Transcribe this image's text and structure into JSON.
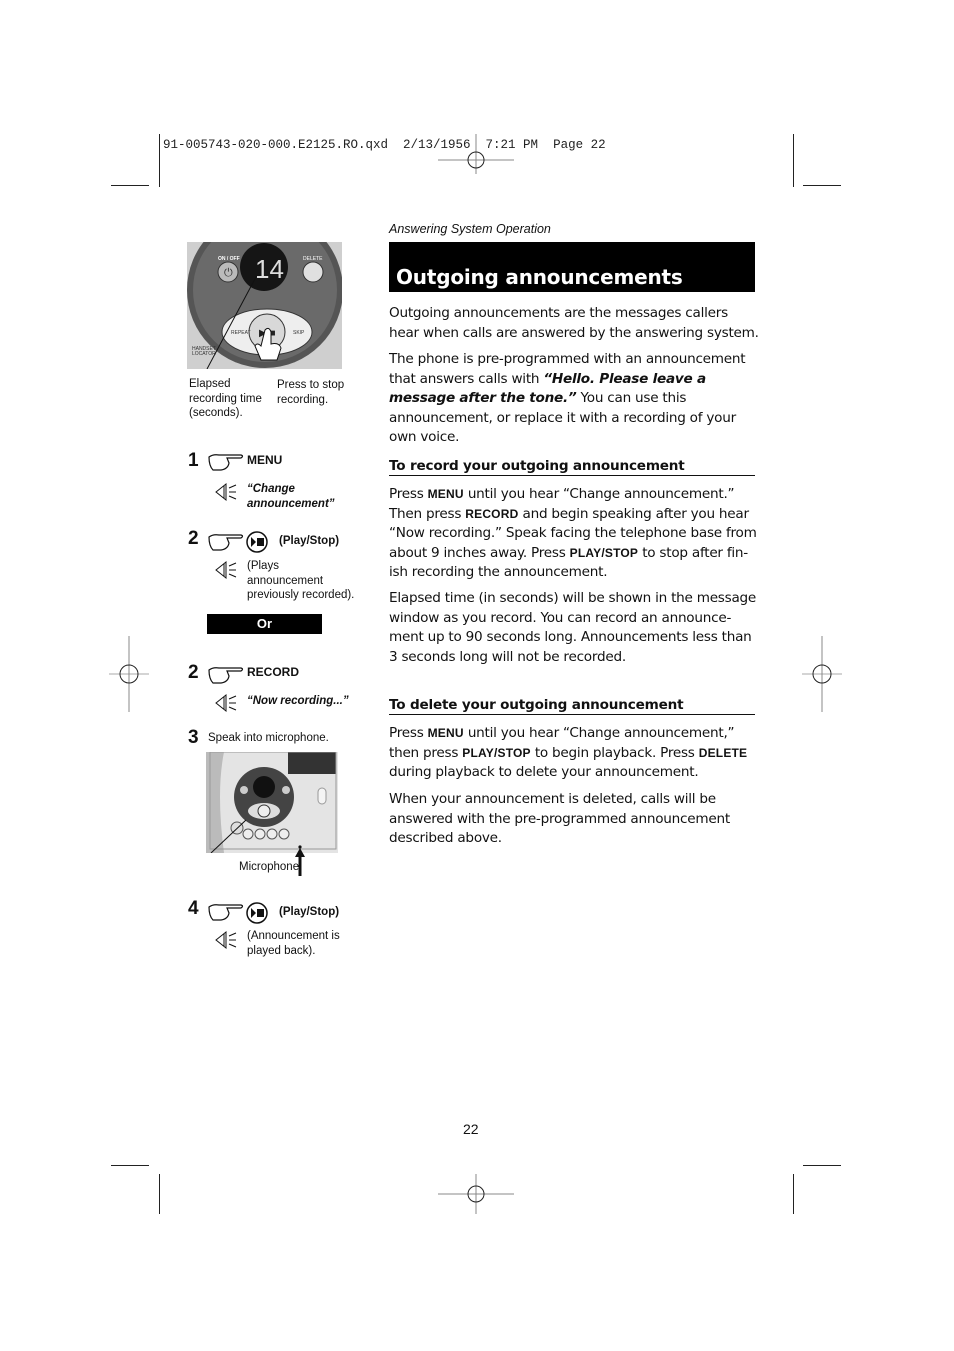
{
  "slug_line": "91-005743-020-000.E2125.RO.qxd  2/13/1956  7:21 PM  Page 22",
  "section_label": "Answering System Operation",
  "title": "Outgoing announcements",
  "intro": {
    "p1": "Outgoing announcements are the messages callers hear when calls are answered by the answering system.",
    "p2_a": "The phone is pre-programmed with an announcement that answers calls with ",
    "p2_quote": "“Hello. Please leave a message after the tone.”",
    "p2_b": " You can use this announcement, or replace it with a recording of your own voice."
  },
  "record_section": {
    "heading": "To record your outgoing announcement",
    "p1_a": "Press ",
    "kw_menu": "MENU",
    "p1_b": " until you hear “Change announcement.” Then press ",
    "kw_record": "RECORD",
    "p1_c": " and begin speaking after you hear “Now recording.” Speak facing the telephone base from about 9 inches away. Press ",
    "kw_playstop": "PLAY/STOP",
    "p1_d": " to stop after fin-ish recording the announcement.",
    "p2": "Elapsed time (in seconds) will be shown in the message window as you record. You can record an announce-ment up to 90 seconds long. Announcements less than 3 seconds long will not be recorded."
  },
  "delete_section": {
    "heading": "To delete your outgoing announcement",
    "p1_a": "Press ",
    "kw_menu": "MENU",
    "p1_b": " until you hear “Change announcement,” then press ",
    "kw_playstop": "PLAY/STOP",
    "p1_c": " to begin playback. Press ",
    "kw_delete": "DELETE",
    "p1_d": " during playback to delete your announcement.",
    "p2": "When your announcement is deleted, calls will be answered with the pre-programmed announcement described above."
  },
  "device_panel": {
    "display": "14",
    "on_off_label": "ON / OFF",
    "delete_label": "DELETE",
    "repeat_label": "REPEAT",
    "skip_label": "SKIP",
    "handset_locator_label": "HANDSET LOCATOR",
    "caption_left": "Elapsed recording time (seconds).",
    "caption_right": "Press to stop recording."
  },
  "steps": [
    {
      "num": "1",
      "key": "MENU",
      "icon": "pointing-hand-icon",
      "voice": "“Change announcement”"
    },
    {
      "num": "2",
      "key": "(Play/Stop)",
      "icon": "play-stop-button-icon",
      "voice": "(Plays announcement previously recorded)."
    },
    {
      "or": "Or"
    },
    {
      "num": "2",
      "key": "RECORD",
      "icon": "pointing-hand-icon",
      "voice": "“Now recording...”"
    },
    {
      "num": "3",
      "text": "Speak into microphone."
    },
    {
      "num": "4",
      "key": "(Play/Stop)",
      "icon": "play-stop-button-icon",
      "voice": "(Announcement is played back)."
    }
  ],
  "microphone_label": "Microphone",
  "page_number": "22"
}
